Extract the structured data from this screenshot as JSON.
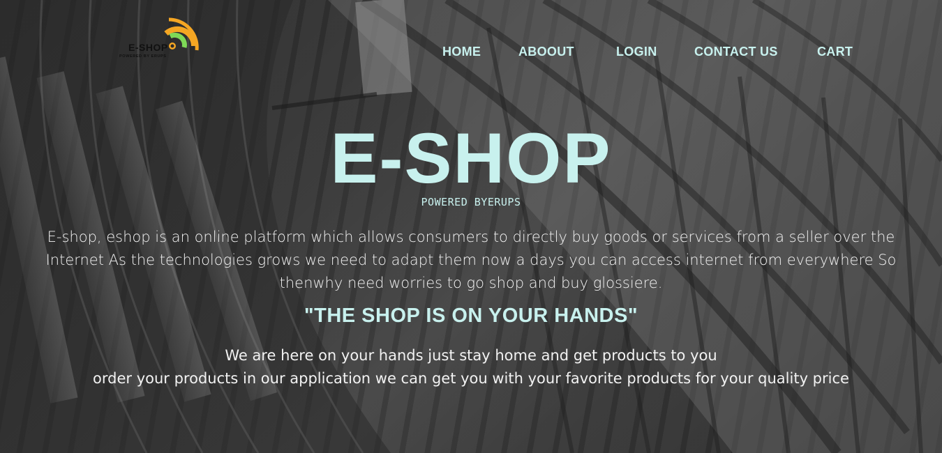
{
  "brand": {
    "logo_text": "E-SHOP",
    "logo_subtext": "POWERED BY ERUPS",
    "colors": {
      "accent": "#c8f1ee",
      "logo_orange": "#f5a623",
      "logo_green": "#7ed957"
    }
  },
  "nav": {
    "items": [
      {
        "label": "HOME"
      },
      {
        "label": "ABOOUT"
      },
      {
        "label": "LOGIN"
      },
      {
        "label": "CONTACT US"
      },
      {
        "label": "CART"
      }
    ]
  },
  "hero": {
    "title": "E-SHOP",
    "subtitle": "POWERED BYERUPS",
    "description": "E-shop, eshop is an online platform which allows consumers to directly buy goods or services from a seller over the Internet As the technologies grows we need to adapt them now a days you can access internet from everywhere So thenwhy need worries to go shop and buy glossiere.",
    "tagline": "\"THE SHOP IS ON YOUR HANDS\"",
    "closing_line1": "We are here on your hands just stay home and get products to you",
    "closing_line2": "order your products in our application we can get you with your favorite products for your quality price"
  },
  "icons": {
    "logo_icon": "wifi-signal-icon"
  }
}
